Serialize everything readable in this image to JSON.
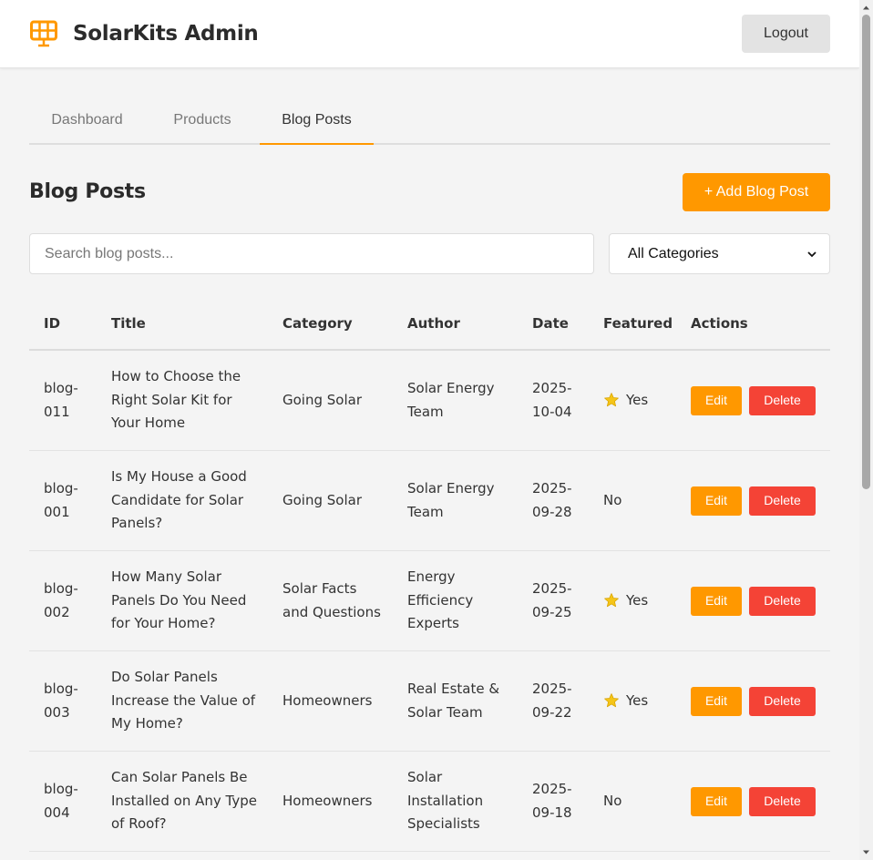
{
  "header": {
    "app_title": "SolarKits Admin",
    "logo_icon": "solar-panel-icon",
    "logout_label": "Logout"
  },
  "tabs": [
    {
      "label": "Dashboard",
      "active": false
    },
    {
      "label": "Products",
      "active": false
    },
    {
      "label": "Blog Posts",
      "active": true
    }
  ],
  "page": {
    "title": "Blog Posts",
    "add_button_label": "+ Add Blog Post"
  },
  "filters": {
    "search_placeholder": "Search blog posts...",
    "search_value": "",
    "category_selected": "All Categories"
  },
  "table": {
    "columns": [
      "ID",
      "Title",
      "Category",
      "Author",
      "Date",
      "Featured",
      "Actions"
    ],
    "rows": [
      {
        "id": [
          "blog-",
          "011"
        ],
        "title": [
          "How to Choose the",
          "Right Solar Kit for",
          "Your Home"
        ],
        "category": [
          "Going Solar"
        ],
        "author": [
          "Solar Energy",
          "Team"
        ],
        "date": [
          "2025-",
          "10-04"
        ],
        "featured": "Yes",
        "featured_flag": true
      },
      {
        "id": [
          "blog-",
          "001"
        ],
        "title": [
          "Is My House a Good",
          "Candidate for Solar",
          "Panels?"
        ],
        "category": [
          "Going Solar"
        ],
        "author": [
          "Solar Energy",
          "Team"
        ],
        "date": [
          "2025-",
          "09-28"
        ],
        "featured": "No",
        "featured_flag": false
      },
      {
        "id": [
          "blog-",
          "002"
        ],
        "title": [
          "How Many Solar",
          "Panels Do You Need",
          "for Your Home?"
        ],
        "category": [
          "Solar Facts",
          "and Questions"
        ],
        "author": [
          "Energy",
          "Efficiency",
          "Experts"
        ],
        "date": [
          "2025-",
          "09-25"
        ],
        "featured": "Yes",
        "featured_flag": true
      },
      {
        "id": [
          "blog-",
          "003"
        ],
        "title": [
          "Do Solar Panels",
          "Increase the Value of",
          "My Home?"
        ],
        "category": [
          "Homeowners"
        ],
        "author": [
          "Real Estate &",
          "Solar Team"
        ],
        "date": [
          "2025-",
          "09-22"
        ],
        "featured": "Yes",
        "featured_flag": true
      },
      {
        "id": [
          "blog-",
          "004"
        ],
        "title": [
          "Can Solar Panels Be",
          "Installed on Any Type",
          "of Roof?"
        ],
        "category": [
          "Homeowners"
        ],
        "author": [
          "Solar",
          "Installation",
          "Specialists"
        ],
        "date": [
          "2025-",
          "09-18"
        ],
        "featured": "No",
        "featured_flag": false
      }
    ],
    "edit_label": "Edit",
    "delete_label": "Delete"
  },
  "colors": {
    "accent": "#ff9800",
    "danger": "#f44336",
    "star": "#f5c518"
  }
}
